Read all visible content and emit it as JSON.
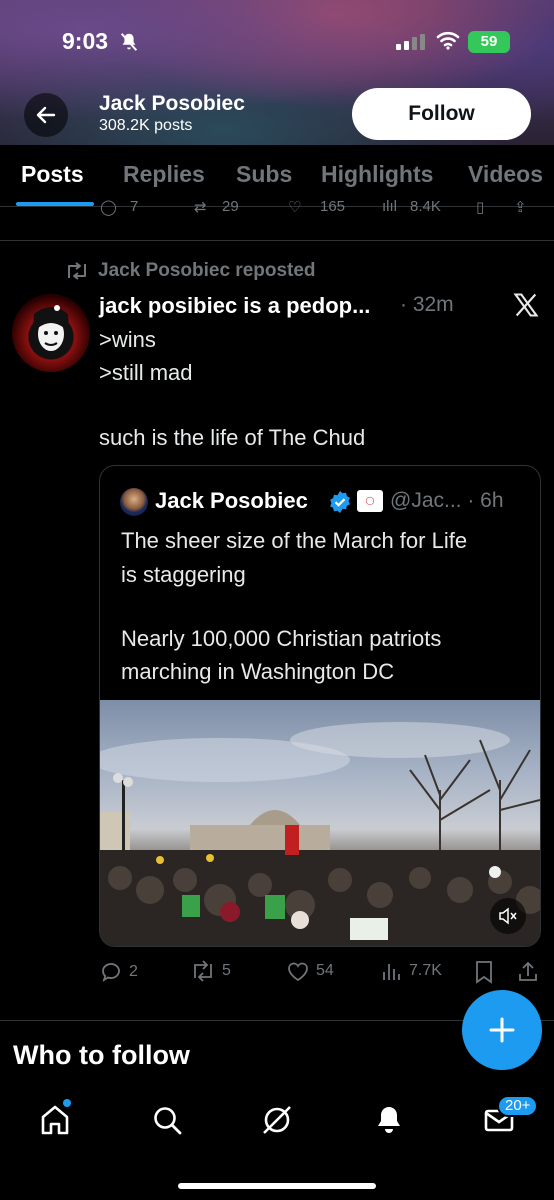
{
  "status_bar": {
    "time": "9:03",
    "battery": "59"
  },
  "header": {
    "name": "Jack Posobiec",
    "posts": "308.2K posts",
    "follow_label": "Follow"
  },
  "tabs": [
    {
      "label": "Posts",
      "active": true
    },
    {
      "label": "Replies"
    },
    {
      "label": "Subs"
    },
    {
      "label": "Highlights"
    },
    {
      "label": "Videos"
    }
  ],
  "prev_tweet_actions": {
    "replies": "7",
    "reposts": "29",
    "likes": "165",
    "views": "8.4K"
  },
  "tweet": {
    "repost_label": "Jack Posobiec reposted",
    "author": "jack posibiec is a pedop...",
    "time": "· 32m",
    "lines": [
      ">wins",
      ">still mad",
      "such is the life of The Chud"
    ],
    "quote": {
      "author": "Jack Posobiec",
      "handle": "@Jac... · 6h",
      "lines": [
        "The sheer size of the March for Life",
        "is staggering",
        "Nearly 100,000 Christian patriots",
        "marching in Washington DC"
      ]
    },
    "actions": {
      "replies": "2",
      "reposts": "5",
      "likes": "54",
      "views": "7.7K"
    }
  },
  "who_to_follow": "Who to follow",
  "bottom_nav": {
    "messages_badge": "20+"
  },
  "colors": {
    "accent": "#1d9bf0",
    "muted": "#71767b",
    "background": "#000000"
  }
}
